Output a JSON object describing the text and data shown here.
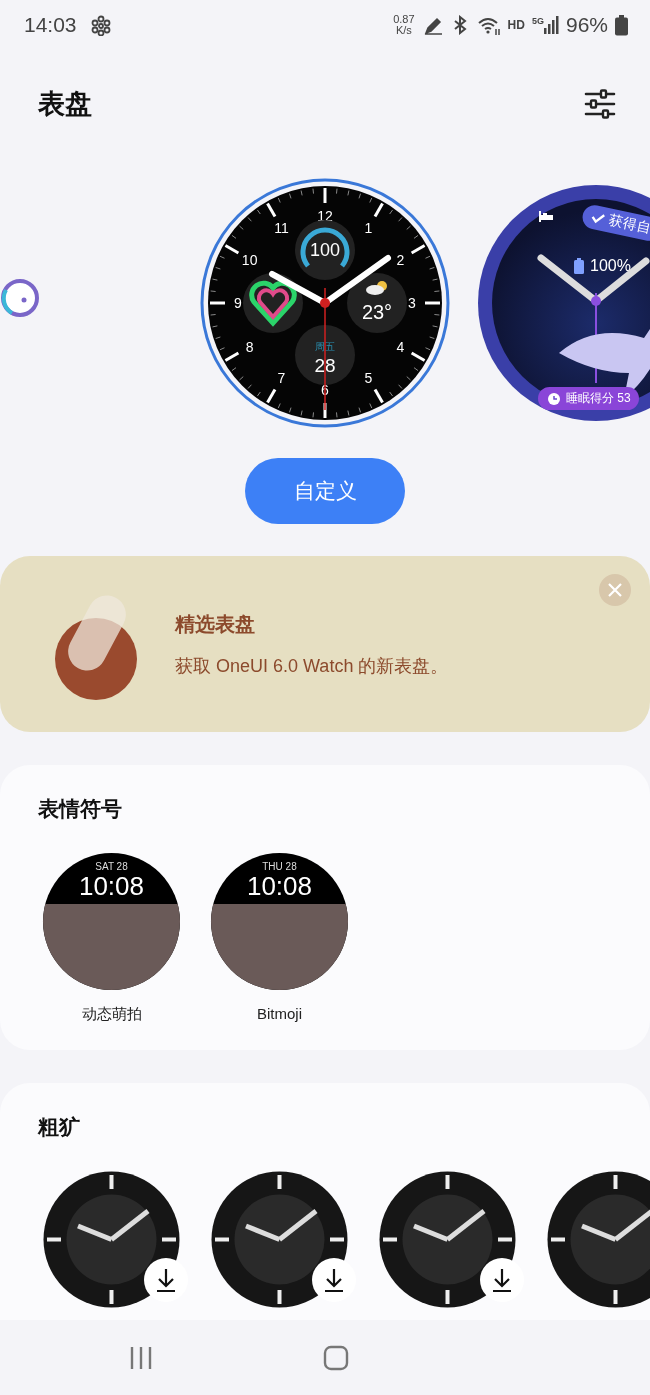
{
  "status_bar": {
    "time": "14:03",
    "net_speed_value": "0.87",
    "net_speed_unit": "K/s",
    "hd_label": "HD",
    "network_label": "5G",
    "battery": "96%"
  },
  "header": {
    "title": "表盘"
  },
  "carousel": {
    "current_face": {
      "numerals": [
        "12",
        "1",
        "2",
        "3",
        "4",
        "5",
        "6",
        "7",
        "8",
        "9",
        "10",
        "11"
      ],
      "battery": "100",
      "weather": "23°",
      "weekday": "周五",
      "date": "28",
      "selected": true
    },
    "next_face": {
      "goal_label": "获得自",
      "battery": "100%",
      "sleep_score": "睡眠得分 53",
      "selected": false
    }
  },
  "customize_button": {
    "label": "自定义"
  },
  "promo_banner": {
    "title": "精选表盘",
    "subtitle": "获取 OneUI 6.0 Watch 的新表盘。"
  },
  "sections": [
    {
      "title": "表情符号",
      "kind": "avatar",
      "items": [
        {
          "date": "SAT 28",
          "time": "10:08",
          "label": "动态萌拍"
        },
        {
          "date": "THU 28",
          "time": "10:08",
          "label": "Bitmoji"
        }
      ]
    },
    {
      "title": "粗犷",
      "kind": "watch",
      "items": [
        {
          "download": true
        },
        {
          "download": true
        },
        {
          "download": true
        },
        {
          "download": false
        }
      ]
    }
  ]
}
